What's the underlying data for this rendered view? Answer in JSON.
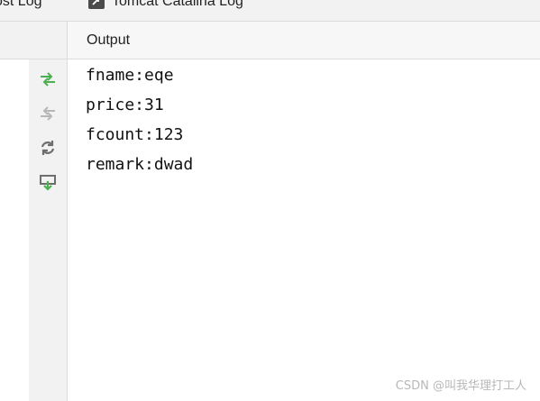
{
  "tabs": [
    {
      "label": "ost Log",
      "icon": "log-icon"
    },
    {
      "label": "Tomcat Catalina Log",
      "icon": "log-icon"
    }
  ],
  "output_panel": {
    "title": "Output",
    "lines": [
      "fname:eqe",
      "price:31",
      "fcount:123",
      "remark:dwad"
    ]
  },
  "toolbar": [
    {
      "icon": "scroll-to-end-icon",
      "color": "#4caf50"
    },
    {
      "icon": "up-stack-trace-icon",
      "color": "#b7b7b7"
    },
    {
      "icon": "rerun-icon",
      "color": "#6e6e6e"
    },
    {
      "icon": "soft-wrap-icon",
      "color": "#4caf50"
    }
  ],
  "watermark": "CSDN @叫我华理打工人"
}
